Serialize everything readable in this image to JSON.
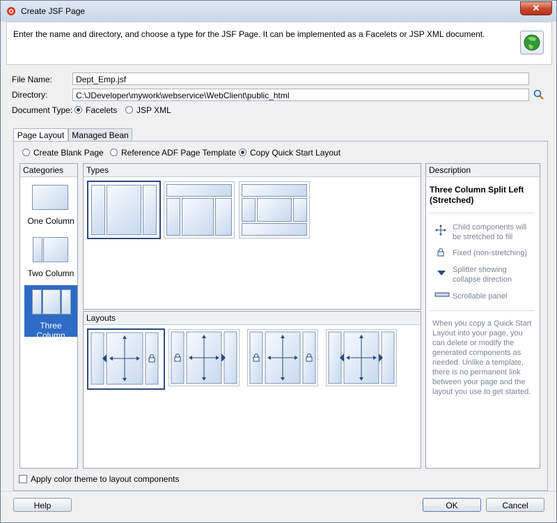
{
  "window": {
    "title": "Create JSF Page",
    "close_label": "✕"
  },
  "header": {
    "description": "Enter the name and directory, and choose a type for the JSF Page. It can be implemented as a Facelets or JSP XML document."
  },
  "form": {
    "file_name_label": "File Name:",
    "file_name_value": "Dept_Emp.jsf",
    "directory_label": "Directory:",
    "directory_value": "C:\\JDeveloper\\mywork\\webservice\\WebClient\\public_html",
    "document_type_label": "Document Type:",
    "facelets_label": "Facelets",
    "jspxml_label": "JSP XML",
    "document_type_selected": "Facelets"
  },
  "tabs": [
    {
      "label": "Page Layout"
    },
    {
      "label": "Managed Bean"
    }
  ],
  "layout_options": {
    "create_blank": "Create Blank Page",
    "reference_adf": "Reference ADF Page Template",
    "copy_quick": "Copy Quick Start Layout",
    "selected": "Copy Quick Start Layout"
  },
  "categories": {
    "header": "Categories",
    "items": [
      {
        "label": "One Column"
      },
      {
        "label": "Two Column"
      },
      {
        "label": "Three Column"
      }
    ],
    "selected": "Three Column"
  },
  "types": {
    "header": "Types"
  },
  "layouts": {
    "header": "Layouts"
  },
  "description": {
    "header": "Description",
    "title": "Three Column Split Left (Stretched)",
    "legend": [
      {
        "text": "Child components will be stretched to fill",
        "icon": "move-arrows-icon"
      },
      {
        "text": "Fixed (non-stretching)",
        "icon": "lock-icon"
      },
      {
        "text": "Splitter showing collapse direction",
        "icon": "triangle-down-icon"
      },
      {
        "text": "Scrollable panel",
        "icon": "scroll-panel-icon"
      }
    ],
    "body": "When you copy a Quick Start Layout into your page, you can delete or modify the generated components as needed. Unlike a template, there is no permanent link between your page and the layout you use to get started."
  },
  "apply_theme_label": "Apply color theme to layout components",
  "buttons": {
    "help": "Help",
    "ok": "OK",
    "cancel": "Cancel"
  },
  "colors": {
    "selection": "#2e6bc4",
    "accent_dark": "#2b4a7d"
  }
}
